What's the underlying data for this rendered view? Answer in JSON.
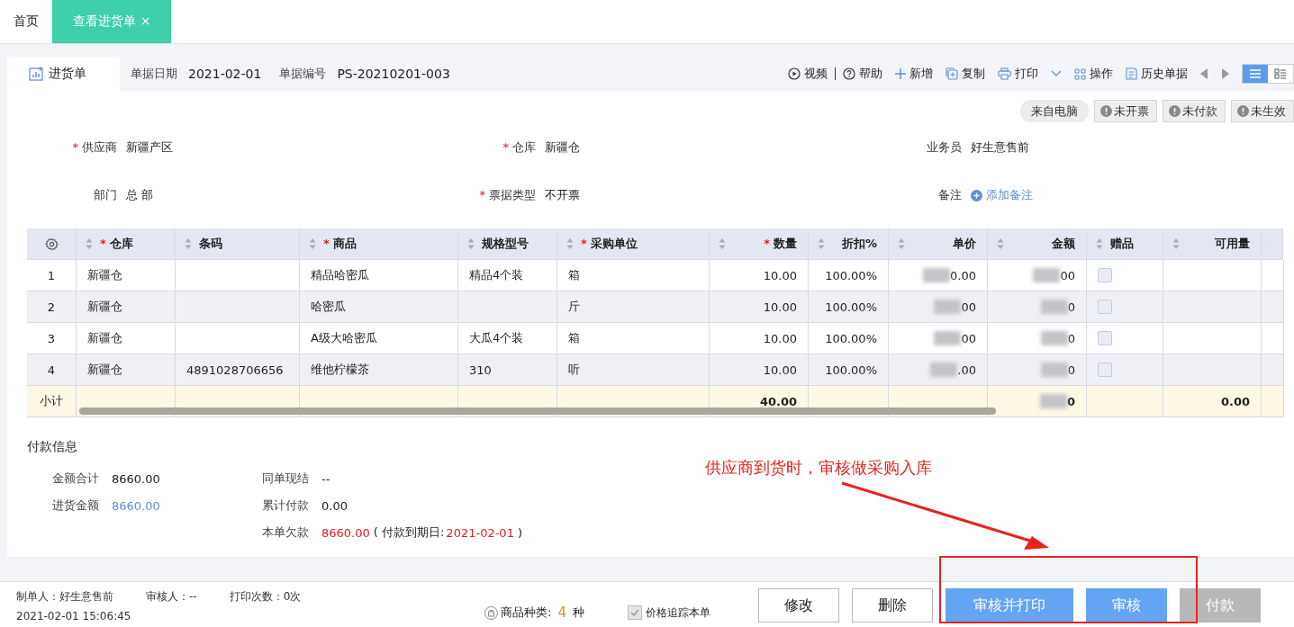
{
  "tabs": [
    {
      "label": "首页",
      "selected": false
    },
    {
      "label": "查看进货单",
      "selected": true,
      "close": "×"
    }
  ],
  "doc": {
    "title": "进货单",
    "date_label": "单据日期",
    "date": "2021-02-01",
    "number_label": "单据编号",
    "number": "PS-20210201-003"
  },
  "toolbar": [
    {
      "kind": "video",
      "label": "视频"
    },
    {
      "kind": "help",
      "label": "帮助"
    },
    {
      "kind": "add",
      "label": "新增"
    },
    {
      "kind": "copy",
      "label": "复制"
    },
    {
      "kind": "print",
      "label": "打印"
    },
    {
      "kind": "ops",
      "label": "操作"
    },
    {
      "kind": "history",
      "label": "历史单据"
    }
  ],
  "view_modes": [
    {
      "kind": "list",
      "selected": true
    },
    {
      "kind": "detail",
      "selected": false
    }
  ],
  "badges": [
    {
      "kind": "source",
      "label": "来自电脑"
    },
    {
      "kind": "warning",
      "label": "未开票"
    },
    {
      "kind": "warning",
      "label": "未付款"
    },
    {
      "kind": "warning",
      "label": "未生效"
    }
  ],
  "fields": [
    {
      "mark": "*",
      "label": "供应商",
      "value": "新疆产区",
      "kind": "text"
    },
    {
      "mark": "*",
      "label": "仓库",
      "value": "新疆仓",
      "kind": "text"
    },
    {
      "label": "业务员",
      "value": "好生意售前",
      "kind": "text"
    },
    {
      "label": "部门",
      "value": "总 部",
      "kind": "text"
    },
    {
      "mark": "*",
      "label": "票据类型",
      "value": "不开票",
      "kind": "text"
    },
    {
      "label": "备注",
      "value": "添加备注",
      "kind": "link"
    }
  ],
  "table": {
    "columns": [
      {
        "mark": "*",
        "label": "仓库"
      },
      {
        "label": "条码"
      },
      {
        "mark": "*",
        "label": "商品"
      },
      {
        "label": "规格型号"
      },
      {
        "mark": "*",
        "label": "采购单位"
      },
      {
        "mark": "*",
        "label": "数量"
      },
      {
        "label": "折扣%"
      },
      {
        "label": "单价"
      },
      {
        "label": "金额"
      },
      {
        "label": "赠品"
      },
      {
        "label": "可用量"
      }
    ],
    "rows": [
      {
        "index": "1",
        "warehouse": "新疆仓",
        "product": "精品哈密瓜",
        "spec": "精品4个装",
        "unit": "箱",
        "qty": "10.00",
        "discount": "100.00%",
        "price": "0.00",
        "amount": "00",
        "gift": false
      },
      {
        "index": "2",
        "warehouse": "新疆仓",
        "product": "哈密瓜",
        "unit": "斤",
        "qty": "10.00",
        "discount": "100.00%",
        "price": "00",
        "amount": "0",
        "gift": false
      },
      {
        "index": "3",
        "warehouse": "新疆仓",
        "product": "A级大哈密瓜",
        "spec": "大瓜4个装",
        "unit": "箱",
        "qty": "10.00",
        "discount": "100.00%",
        "price": "00",
        "amount": "0",
        "gift": false
      },
      {
        "index": "4",
        "warehouse": "新疆仓",
        "barcode": "4891028706656",
        "product": "维他柠檬茶",
        "spec": "310",
        "unit": "听",
        "qty": "10.00",
        "discount": "100.00%",
        "price": ".00",
        "amount": "0",
        "gift": false
      }
    ],
    "subtotal": {
      "label": "小计",
      "qty": "40.00",
      "amount": "0",
      "available": "0.00"
    }
  },
  "payment": {
    "title": "付款信息",
    "left": [
      {
        "label": "金额合计",
        "value": "8660.00",
        "color": "#222222"
      },
      {
        "label": "进货金额",
        "value": "8660.00",
        "color": "#5b8fd9"
      }
    ],
    "right": [
      {
        "label": "同单现结",
        "value": "--",
        "color": "#222222"
      },
      {
        "label": "累计付款",
        "value": "0.00",
        "color": "#222222"
      },
      {
        "label": "本单欠款",
        "value": "8660.00",
        "color": "#e02020",
        "due_prefix": "( 付款到期日:",
        "due_date": "2021-02-01",
        "due_suffix": ")"
      }
    ]
  },
  "annotation": {
    "text": "供应商到货时，审核做采购入库"
  },
  "footer": {
    "meta": [
      {
        "text": "制单人：好生意售前"
      },
      {
        "text": "审核人：--"
      },
      {
        "text": "打印次数：0次"
      }
    ],
    "created": "2021-02-01 15:06:45",
    "product_kinds": {
      "label": "商品种类:",
      "count": "4",
      "unit": "种"
    },
    "price_track": {
      "label": "价格追踪本单",
      "checked": true
    },
    "buttons": [
      {
        "label": "修改",
        "kind": "default",
        "disabled": false
      },
      {
        "label": "删除",
        "kind": "default",
        "disabled": false
      },
      {
        "label": "审核并打印",
        "kind": "primary",
        "disabled": false
      },
      {
        "label": "审核",
        "kind": "primary",
        "disabled": false
      },
      {
        "label": "付款",
        "kind": "primary",
        "disabled": true
      }
    ]
  }
}
